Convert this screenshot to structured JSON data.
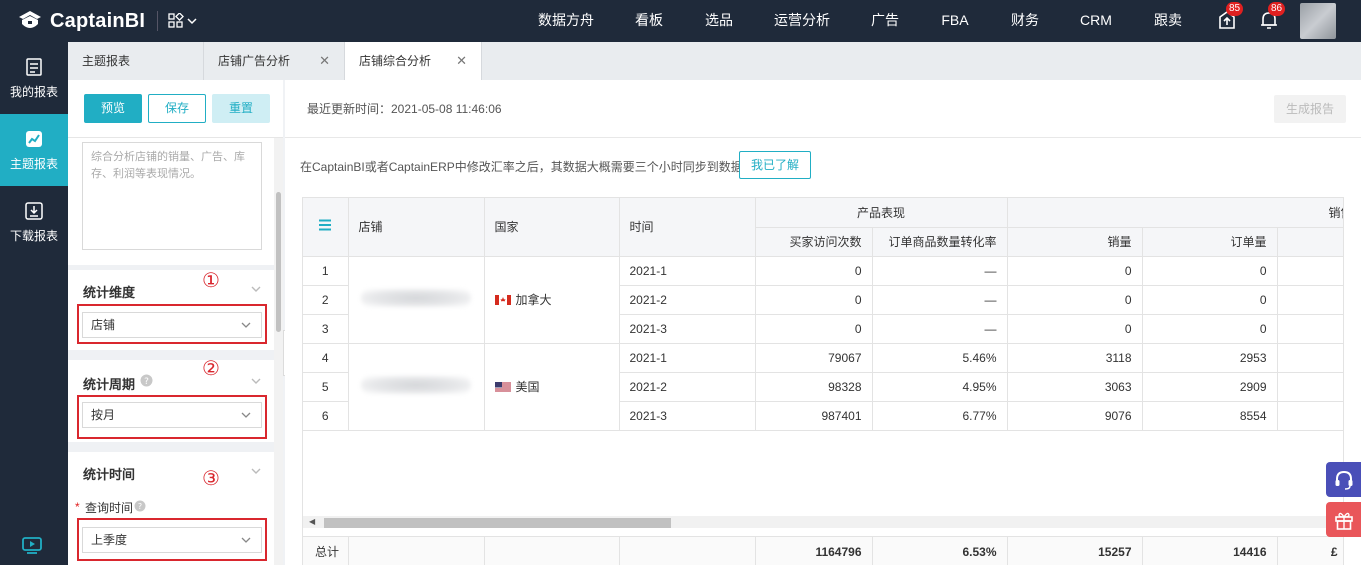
{
  "app": {
    "logo_text": "CaptainBI"
  },
  "topnav": {
    "items": [
      "数据方舟",
      "看板",
      "选品",
      "运营分析",
      "广告",
      "FBA",
      "财务",
      "CRM",
      "跟卖"
    ],
    "notification_badge_1": "85",
    "notification_badge_2": "86"
  },
  "leftrail": {
    "items": [
      {
        "label": "我的报表",
        "icon": "report-icon"
      },
      {
        "label": "主题报表",
        "icon": "chart-icon"
      },
      {
        "label": "下载报表",
        "icon": "download-icon"
      }
    ],
    "active": "主题报表"
  },
  "tabs": [
    {
      "label": "主题报表",
      "closable": false
    },
    {
      "label": "店铺广告分析",
      "closable": true
    },
    {
      "label": "店铺综合分析",
      "closable": true,
      "active": true
    }
  ],
  "config": {
    "preview_label": "预览",
    "save_label": "保存",
    "reset_label": "重置",
    "description": "综合分析店铺的销量、广告、库存、利润等表现情况。",
    "sections": [
      {
        "title": "统计维度",
        "value": "店铺",
        "marker": "①"
      },
      {
        "title": "统计周期",
        "value": "按月",
        "marker": "②"
      },
      {
        "title": "统计时间",
        "field_label": "查询时间",
        "value": "上季度",
        "marker": "③"
      }
    ]
  },
  "main": {
    "last_updated": "最近更新时间：2021-05-08 11:46:06",
    "generate_label": "生成报告",
    "notice": "在CaptainBI或者CaptainERP中修改汇率之后，其数据大概需要三个小时同步到数据方舟",
    "ack_label": "我已了解"
  },
  "table": {
    "headers": {
      "shop": "店铺",
      "country": "国家",
      "time": "时间",
      "group_product": "产品表现",
      "group_sales": "销售",
      "visits": "买家访问次数",
      "conversion": "订单商品数量转化率",
      "units": "销量",
      "orders": "订单量"
    },
    "countries": [
      {
        "name": "加拿大",
        "flag": "canada-flag-icon"
      },
      {
        "name": "美国",
        "flag": "usa-flag-icon"
      }
    ],
    "rows": [
      {
        "idx": "1",
        "time": "2021-1",
        "visits": "0",
        "conversion": "—",
        "units": "0",
        "orders": "0"
      },
      {
        "idx": "2",
        "time": "2021-2",
        "visits": "0",
        "conversion": "—",
        "units": "0",
        "orders": "0"
      },
      {
        "idx": "3",
        "time": "2021-3",
        "visits": "0",
        "conversion": "—",
        "units": "0",
        "orders": "0"
      },
      {
        "idx": "4",
        "time": "2021-1",
        "visits": "79067",
        "conversion": "5.46%",
        "units": "3118",
        "orders": "2953"
      },
      {
        "idx": "5",
        "time": "2021-2",
        "visits": "98328",
        "conversion": "4.95%",
        "units": "3063",
        "orders": "2909"
      },
      {
        "idx": "6",
        "time": "2021-3",
        "visits": "987401",
        "conversion": "6.77%",
        "units": "9076",
        "orders": "8554"
      }
    ],
    "totals": {
      "label": "总计",
      "visits": "1164796",
      "conversion": "6.53%",
      "units": "15257",
      "orders": "14416",
      "partial": "£"
    }
  },
  "colors": {
    "accent": "#21aec4",
    "nav_bg": "#1f2a3a",
    "marker_red": "#d9272e"
  }
}
